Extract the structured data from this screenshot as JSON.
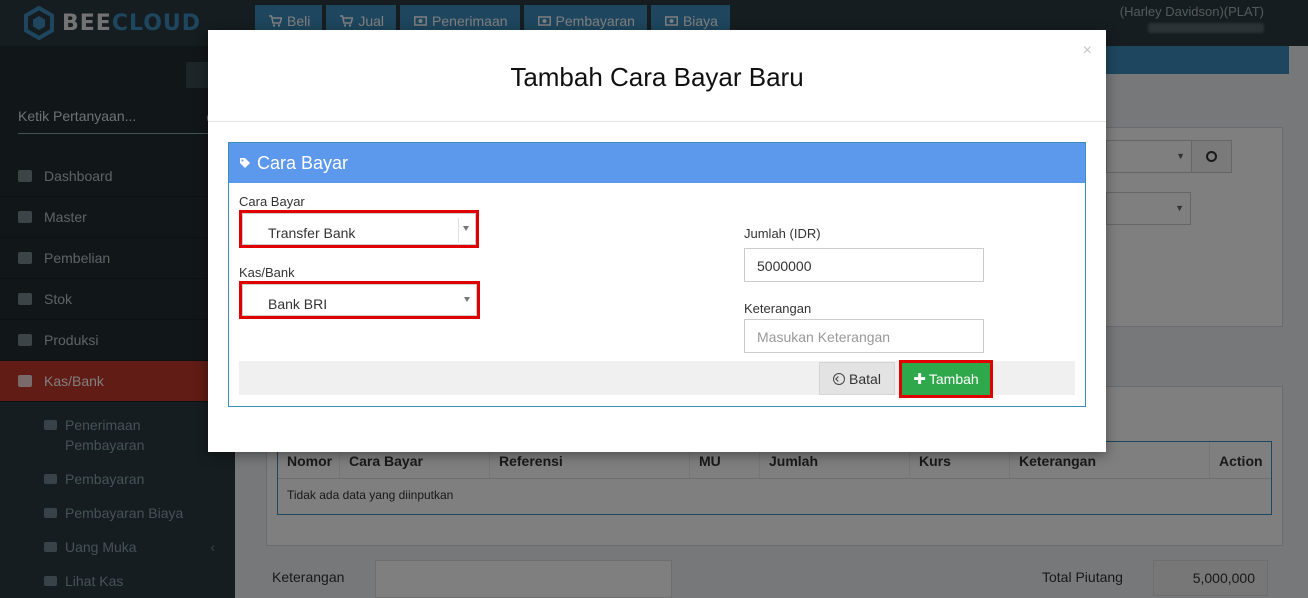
{
  "app": {
    "brand_left": "BEE",
    "brand_right": "CLOUD"
  },
  "topnav": [
    {
      "label": "Beli",
      "icon": "cart-icon"
    },
    {
      "label": "Jual",
      "icon": "cart-icon"
    },
    {
      "label": "Penerimaan",
      "icon": "money-icon"
    },
    {
      "label": "Pembayaran",
      "icon": "money-icon"
    },
    {
      "label": "Biaya",
      "icon": "money-icon"
    }
  ],
  "user": {
    "name": "(Harley Davidson)(PLAT)"
  },
  "sidebar": {
    "search_placeholder": "Ketik Pertanyaan...",
    "items": [
      {
        "label": "Dashboard",
        "icon": "home-icon"
      },
      {
        "label": "Master",
        "icon": "database-icon"
      },
      {
        "label": "Pembelian",
        "icon": "cart-icon"
      },
      {
        "label": "Stok",
        "icon": "grid-icon"
      },
      {
        "label": "Produksi",
        "icon": "industry-icon"
      },
      {
        "label": "Kas/Bank",
        "icon": "money-icon",
        "active": true
      }
    ],
    "subitems": [
      {
        "label": "Penerimaan Pembayaran",
        "icon": "money-icon"
      },
      {
        "label": "Pembayaran",
        "icon": "money-icon"
      },
      {
        "label": "Pembayaran Biaya",
        "icon": "money-icon"
      },
      {
        "label": "Uang Muka",
        "icon": "file-icon",
        "chevron": "‹"
      },
      {
        "label": "Lihat Kas",
        "icon": "bank-icon"
      }
    ]
  },
  "background": {
    "table_headers": [
      "Nomor",
      "Cara Bayar",
      "Referensi",
      "MU",
      "Jumlah",
      "Kurs",
      "Keterangan",
      "Action"
    ],
    "empty_text": "Tidak ada data yang diinputkan",
    "keterangan_label": "Keterangan",
    "total_label": "Total Piutang",
    "total_value": "5,000,000"
  },
  "modal": {
    "close": "×",
    "title": "Tambah Cara Bayar Baru",
    "box_title": "Cara Bayar",
    "cara_bayar_label": "Cara Bayar",
    "cara_bayar_value": "Transfer Bank",
    "kas_bank_label": "Kas/Bank",
    "kas_bank_value": "Bank BRI",
    "jumlah_label": "Jumlah (IDR)",
    "jumlah_value": "5000000",
    "keterangan_label": "Keterangan",
    "keterangan_placeholder": "Masukan Keterangan",
    "batal_label": "Batal",
    "tambah_label": "Tambah"
  },
  "colors": {
    "accent": "#3c8dbc",
    "box_header": "#5c98ec",
    "active_menu": "#c0392b",
    "highlight": "#e00000",
    "success": "#2ea84a"
  }
}
